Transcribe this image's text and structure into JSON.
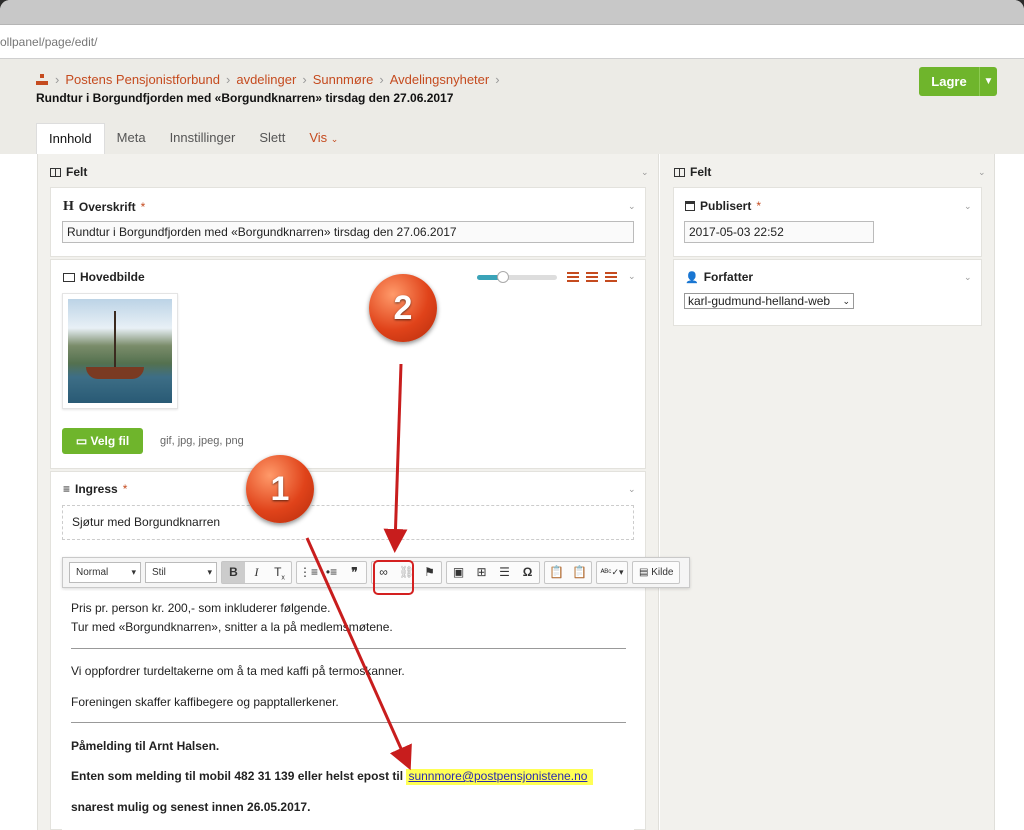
{
  "browser": {
    "url": "ollpanel/page/edit/"
  },
  "breadcrumb": [
    "Postens Pensjonistforbund",
    "avdelinger",
    "Sunnmøre",
    "Avdelingsnyheter"
  ],
  "page_title": "Rundtur i Borgundfjorden med «Borgundknarren» tirsdag den 27.06.2017",
  "save_button": {
    "label": "Lagre"
  },
  "tabs": [
    {
      "label": "Innhold"
    },
    {
      "label": "Meta"
    },
    {
      "label": "Innstillinger"
    },
    {
      "label": "Slett"
    },
    {
      "label": "Vis"
    }
  ],
  "left_panel": {
    "title": "Felt",
    "overskrift": {
      "label": "Overskrift",
      "required": "*",
      "value": "Rundtur i Borgundfjorden med «Borgundknarren» tirsdag den 27.06.2017"
    },
    "hovedbilde": {
      "label": "Hovedbilde",
      "button": "Velg fil",
      "hint": "gif, jpg, jpeg, png"
    },
    "ingress": {
      "label": "Ingress",
      "required": "*",
      "value": "Sjøtur med Borgundknarren"
    }
  },
  "toolbar": {
    "format": "Normal",
    "style": "Stil",
    "source_label": "Kilde"
  },
  "editor": {
    "p1": "Pris pr. person kr. 200,- som inkluderer følgende.",
    "p2": "Tur med «Borgundknarren», snitter a la på medlemsmøtene.",
    "p3": "Vi oppfordrer turdeltakerne om å ta med kaffi på termoskanner.",
    "p4": "Foreningen skaffer kaffibegere og papptallerkener.",
    "p5": "Påmelding til Arnt Halsen.",
    "p6": "Enten som melding til mobil 482 31 139 eller helst epost til",
    "email": "sunnmore@postpensjonistene.no",
    "p7": "snarest mulig og senest innen 26.05.2017."
  },
  "right_panel": {
    "title": "Felt",
    "publisert": {
      "label": "Publisert",
      "required": "*",
      "value": "2017-05-03 22:52"
    },
    "forfatter": {
      "label": "Forfatter",
      "value": "karl-gudmund-helland-web"
    }
  },
  "annotations": {
    "marker1": "1",
    "marker2": "2"
  },
  "colors": {
    "accent": "#c54b1f",
    "primary_button": "#6fb52c",
    "annotation": "#e0431a",
    "highlight": "#ffff55"
  }
}
